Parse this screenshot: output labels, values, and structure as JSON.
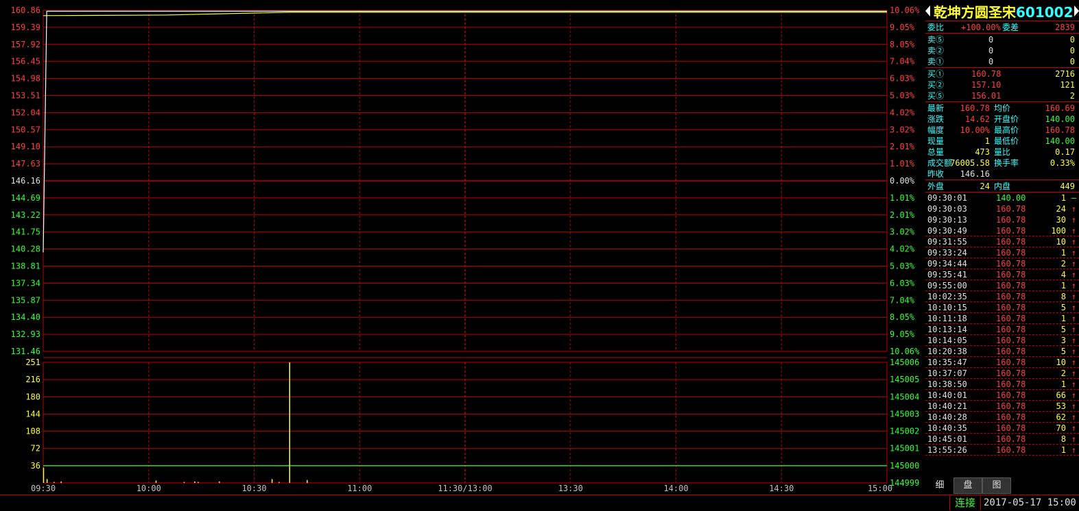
{
  "stock": {
    "name": "乾坤方圆圣宋",
    "code": "601002"
  },
  "colors": {
    "bg": "#000000",
    "grid": "#c00000",
    "up": "#ff4040",
    "down": "#33ff33",
    "flat": "#e0e0e0",
    "vol": "#ffff33",
    "price_line": "#ffffff",
    "avg_line": "#ffff33"
  },
  "chart_data": [
    {
      "type": "line",
      "title": "",
      "prev_close": 146.16,
      "ylim": [
        131.46,
        160.86
      ],
      "price_labels": [
        "160.86",
        "159.39",
        "157.92",
        "156.45",
        "154.98",
        "153.51",
        "152.04",
        "150.57",
        "149.10",
        "147.63",
        "146.16",
        "144.69",
        "143.22",
        "141.75",
        "140.28",
        "138.81",
        "137.34",
        "135.87",
        "134.40",
        "132.93",
        "131.46"
      ],
      "pct_labels": [
        "10.06%",
        "9.05%",
        "8.05%",
        "7.04%",
        "6.03%",
        "5.03%",
        "4.02%",
        "3.02%",
        "2.01%",
        "1.01%",
        "0.00%",
        "1.01%",
        "2.01%",
        "3.02%",
        "4.02%",
        "5.03%",
        "6.03%",
        "7.04%",
        "8.05%",
        "9.05%",
        "10.06%"
      ],
      "time_labels": [
        "09:30",
        "10:00",
        "10:30",
        "11:00",
        "11:30/13:00",
        "13:30",
        "14:00",
        "14:30",
        "15:00"
      ],
      "series": [
        {
          "name": "price",
          "points": [
            [
              0,
              140.0
            ],
            [
              1,
              160.78
            ],
            [
              240,
              160.78
            ]
          ]
        },
        {
          "name": "avg",
          "points": [
            [
              0,
              160.4
            ],
            [
              35,
              160.45
            ],
            [
              70,
              160.69
            ],
            [
              240,
              160.69
            ]
          ]
        }
      ]
    },
    {
      "type": "bar",
      "title": "",
      "ylim": [
        0,
        251
      ],
      "vol_labels": [
        "251",
        "216",
        "180",
        "144",
        "108",
        "72",
        "36"
      ],
      "right_labels": [
        "145006",
        "145005",
        "145004",
        "145003",
        "145002",
        "145001",
        "145000",
        "144999"
      ],
      "flat_line": 145000,
      "series": [
        {
          "name": "volume",
          "points": [
            [
              0,
              32
            ],
            [
              1,
              8
            ],
            [
              3,
              2
            ],
            [
              5,
              3
            ],
            [
              32,
              5
            ],
            [
              40,
              2
            ],
            [
              43,
              3
            ],
            [
              44,
              2
            ],
            [
              50,
              3
            ],
            [
              65,
              8
            ],
            [
              67,
              2
            ],
            [
              70,
              251
            ],
            [
              75,
              6
            ]
          ]
        }
      ]
    }
  ],
  "quote": {
    "weibi_label": "委比",
    "weibi": "+100.00%",
    "weicha_label": "委差",
    "weicha": "2839",
    "sells": [
      {
        "label": "卖⑤",
        "price": "0",
        "vol": "0"
      },
      {
        "label": "卖②",
        "price": "0",
        "vol": "0"
      },
      {
        "label": "卖①",
        "price": "0",
        "vol": "0"
      }
    ],
    "buys": [
      {
        "label": "买①",
        "price": "160.78",
        "vol": "2716"
      },
      {
        "label": "买②",
        "price": "157.10",
        "vol": "121"
      },
      {
        "label": "买⑤",
        "price": "156.01",
        "vol": "2"
      }
    ],
    "stats": [
      {
        "l1": "最新",
        "v1": "160.78",
        "c1": "red",
        "l2": "均价",
        "v2": "160.69",
        "c2": "red"
      },
      {
        "l1": "涨跌",
        "v1": "14.62",
        "c1": "red",
        "l2": "开盘价",
        "v2": "140.00",
        "c2": "grn"
      },
      {
        "l1": "幅度",
        "v1": "10.00%",
        "c1": "red",
        "l2": "最高价",
        "v2": "160.78",
        "c2": "red"
      },
      {
        "l1": "现量",
        "v1": "1",
        "c1": "yel",
        "l2": "最低价",
        "v2": "140.00",
        "c2": "grn"
      },
      {
        "l1": "总量",
        "v1": "473",
        "c1": "yel",
        "l2": "量比",
        "v2": "0.17",
        "c2": "yel"
      },
      {
        "l1": "成交额",
        "v1": "76005.58",
        "c1": "yel",
        "l2": "换手率",
        "v2": "0.33%",
        "c2": "yel"
      },
      {
        "l1": "昨收",
        "v1": "146.16",
        "c1": "wht",
        "l2": "",
        "v2": "",
        "c2": "wht"
      }
    ],
    "outer_label": "外盘",
    "outer": "24",
    "inner_label": "内盘",
    "inner": "449"
  },
  "ticks": [
    {
      "time": "09:30:01",
      "price": "140.00",
      "vol": "1",
      "dir": "—",
      "c": "grn"
    },
    {
      "time": "09:30:03",
      "price": "160.78",
      "vol": "24",
      "dir": "↑",
      "c": "red"
    },
    {
      "time": "09:30:13",
      "price": "160.78",
      "vol": "30",
      "dir": "↑",
      "c": "red"
    },
    {
      "time": "09:30:49",
      "price": "160.78",
      "vol": "100",
      "dir": "↑",
      "c": "red"
    },
    {
      "time": "09:31:55",
      "price": "160.78",
      "vol": "10",
      "dir": "↑",
      "c": "red"
    },
    {
      "time": "09:33:24",
      "price": "160.78",
      "vol": "1",
      "dir": "↑",
      "c": "red"
    },
    {
      "time": "09:34:44",
      "price": "160.78",
      "vol": "2",
      "dir": "↑",
      "c": "red"
    },
    {
      "time": "09:35:41",
      "price": "160.78",
      "vol": "4",
      "dir": "↑",
      "c": "red"
    },
    {
      "time": "09:55:00",
      "price": "160.78",
      "vol": "1",
      "dir": "↑",
      "c": "red"
    },
    {
      "time": "10:02:35",
      "price": "160.78",
      "vol": "8",
      "dir": "↑",
      "c": "red"
    },
    {
      "time": "10:10:15",
      "price": "160.78",
      "vol": "5",
      "dir": "↑",
      "c": "red"
    },
    {
      "time": "10:11:18",
      "price": "160.78",
      "vol": "1",
      "dir": "↑",
      "c": "red"
    },
    {
      "time": "10:13:14",
      "price": "160.78",
      "vol": "5",
      "dir": "↑",
      "c": "red"
    },
    {
      "time": "10:14:05",
      "price": "160.78",
      "vol": "3",
      "dir": "↑",
      "c": "red"
    },
    {
      "time": "10:20:38",
      "price": "160.78",
      "vol": "5",
      "dir": "↑",
      "c": "red"
    },
    {
      "time": "10:35:47",
      "price": "160.78",
      "vol": "10",
      "dir": "↑",
      "c": "red"
    },
    {
      "time": "10:37:07",
      "price": "160.78",
      "vol": "2",
      "dir": "↑",
      "c": "red"
    },
    {
      "time": "10:38:50",
      "price": "160.78",
      "vol": "1",
      "dir": "↑",
      "c": "red"
    },
    {
      "time": "10:40:01",
      "price": "160.78",
      "vol": "66",
      "dir": "↑",
      "c": "red"
    },
    {
      "time": "10:40:21",
      "price": "160.78",
      "vol": "53",
      "dir": "↑",
      "c": "red"
    },
    {
      "time": "10:40:28",
      "price": "160.78",
      "vol": "62",
      "dir": "↑",
      "c": "red"
    },
    {
      "time": "10:40:35",
      "price": "160.78",
      "vol": "70",
      "dir": "↑",
      "c": "red"
    },
    {
      "time": "10:45:01",
      "price": "160.78",
      "vol": "8",
      "dir": "↑",
      "c": "red"
    },
    {
      "time": "13:55:26",
      "price": "160.78",
      "vol": "1",
      "dir": "↑",
      "c": "red"
    }
  ],
  "tabs": [
    "细",
    "盘",
    "图"
  ],
  "status": {
    "connection": "连接",
    "datetime": "2017-05-17 15:00"
  }
}
